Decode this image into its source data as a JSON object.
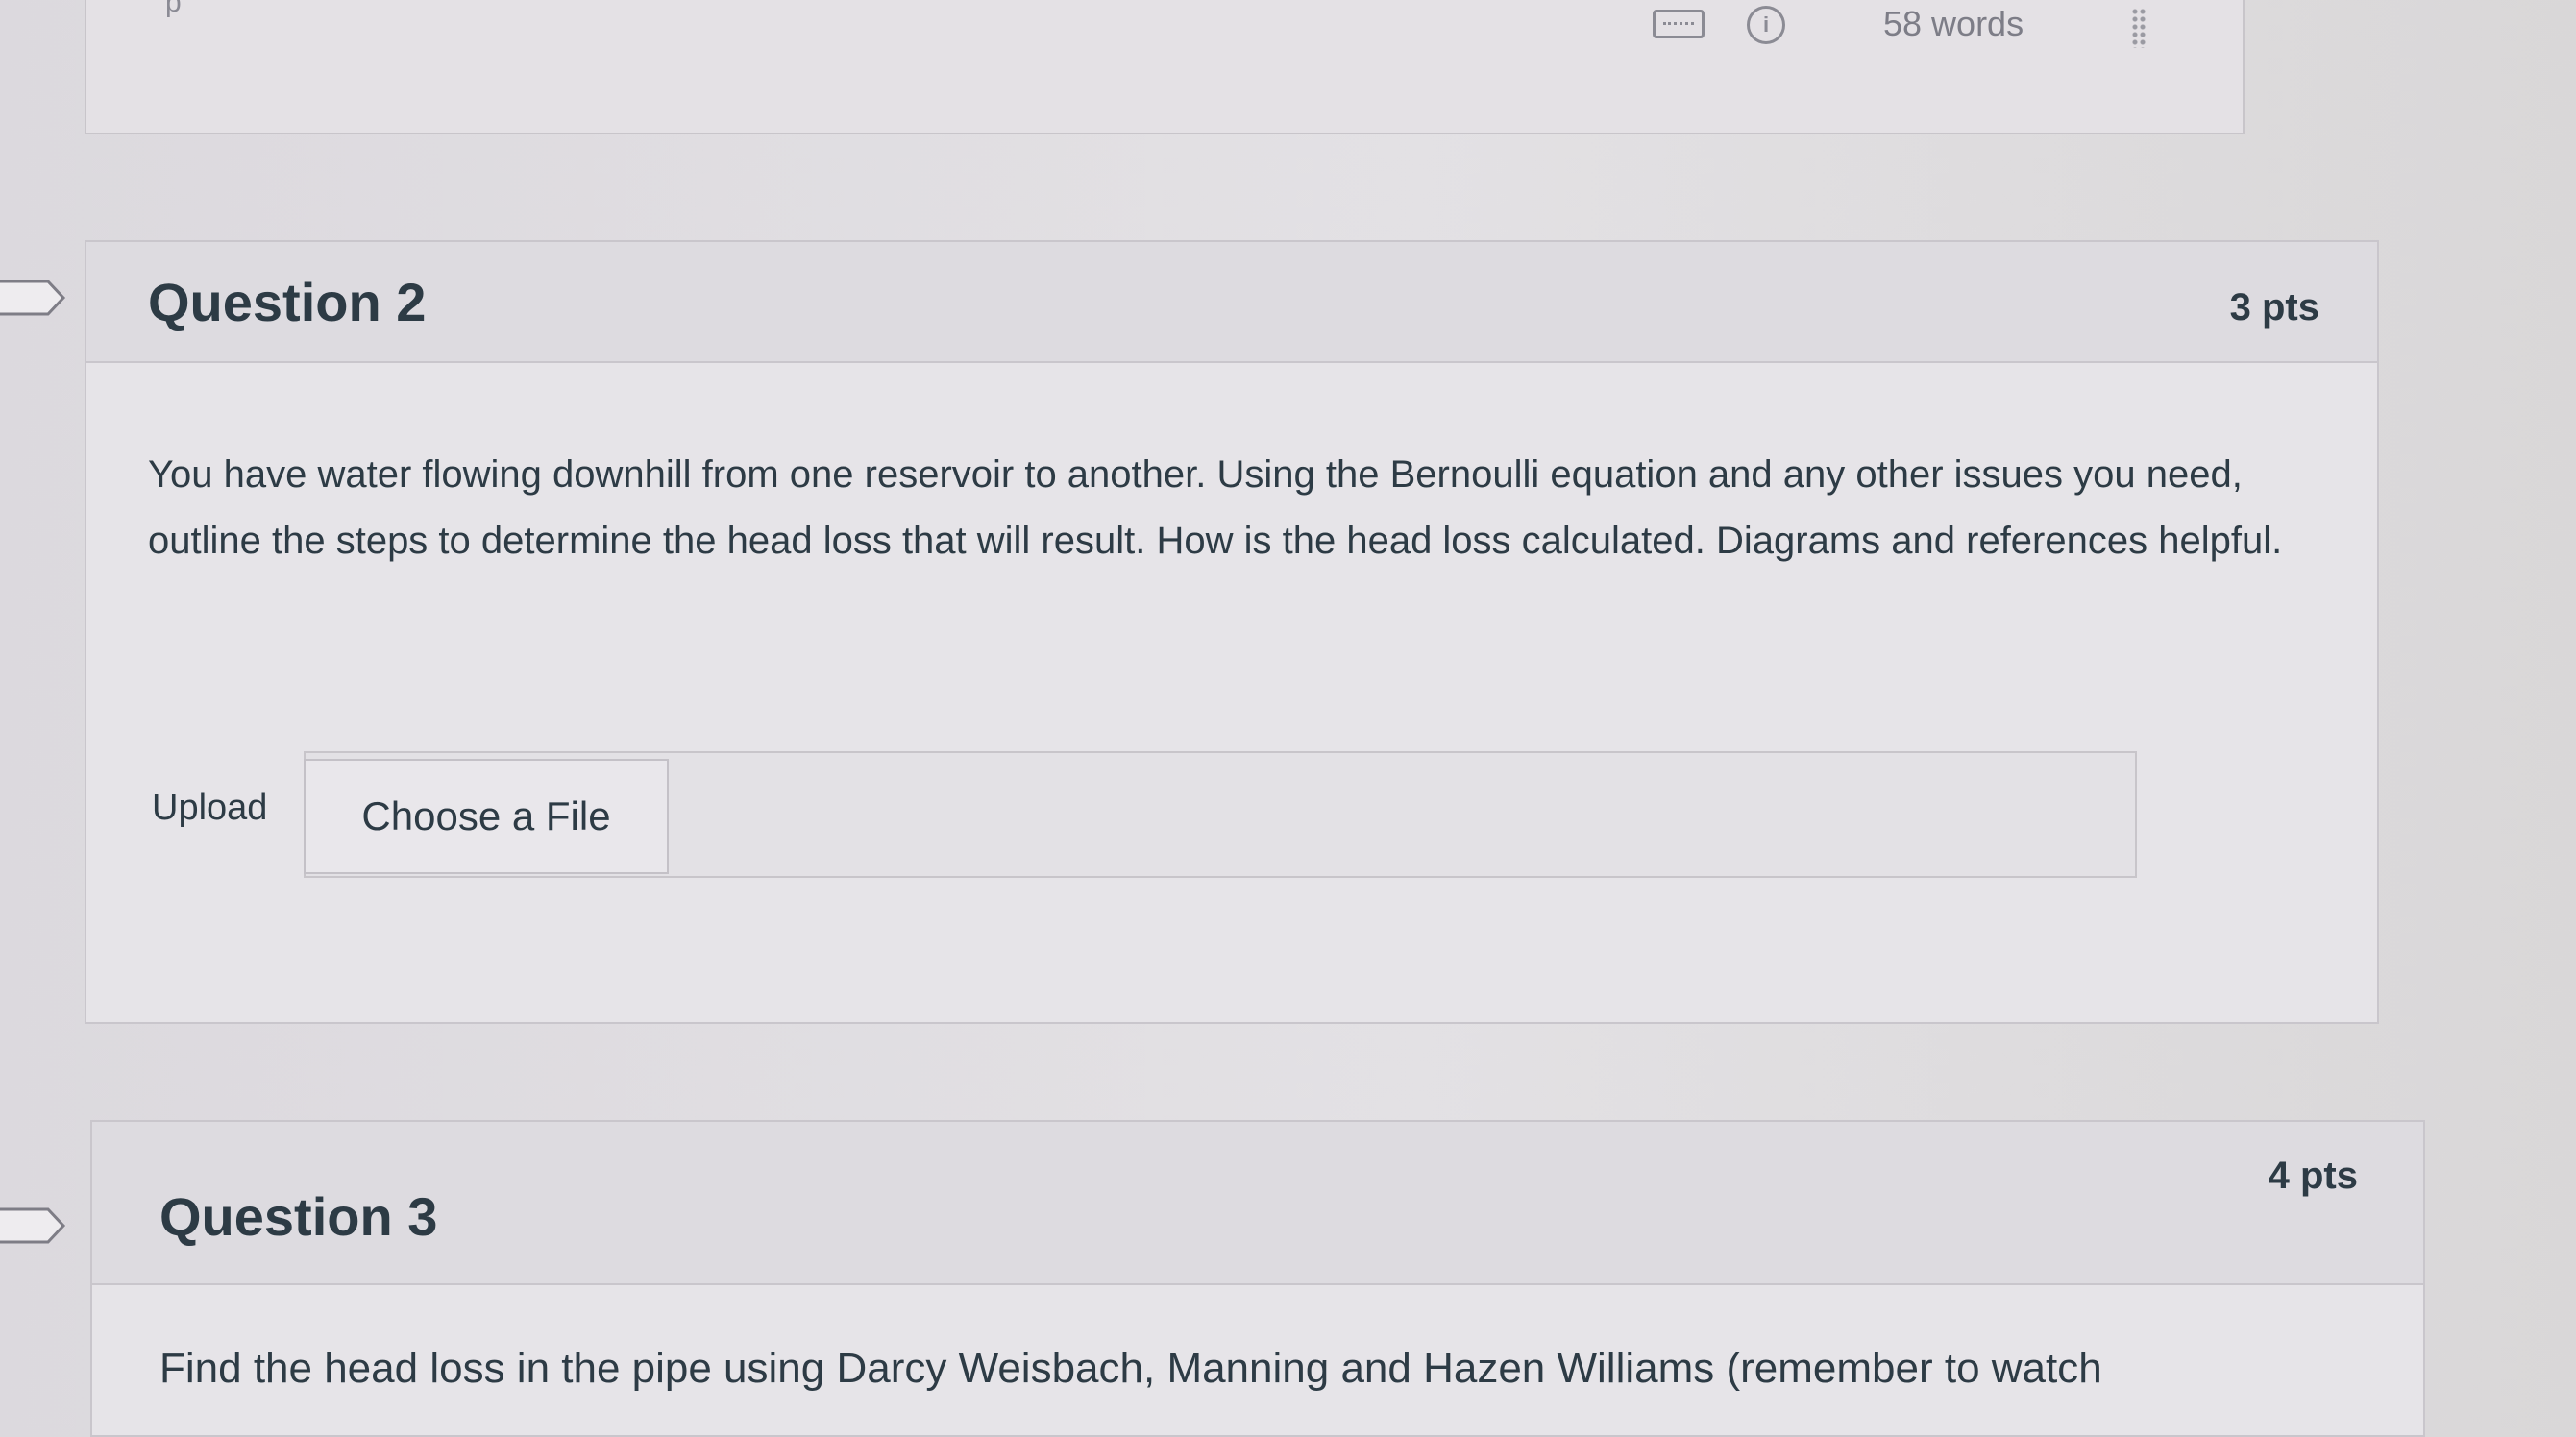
{
  "editor_status": {
    "path_label": "p",
    "keyboard_icon": "keyboard-icon",
    "accessibility_icon": "accessibility-icon",
    "word_count": "58 words",
    "resize_icon": "drag-handle-icon"
  },
  "questions": [
    {
      "title": "Question 2",
      "points": "3 pts",
      "text": "You have water flowing downhill from one reservoir to another.  Using the Bernoulli equation and any other issues you need, outline the steps to determine the head loss that will result.  How is the head loss calculated.  Diagrams and references helpful.",
      "upload_label": "Upload",
      "choose_file_label": "Choose a File"
    },
    {
      "title": "Question 3",
      "points": "4 pts",
      "text": "Find the head loss in the pipe using Darcy Weisbach, Manning and Hazen Williams (remember to watch"
    }
  ],
  "colors": {
    "text": "#2d3b45",
    "card_bg": "#e6e4e8",
    "header_bg": "#dddbe0",
    "border": "#c9c6cc"
  }
}
